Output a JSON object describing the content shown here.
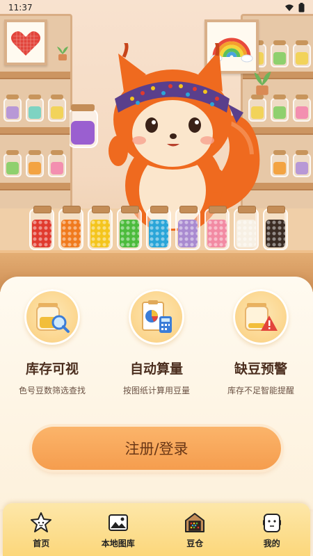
{
  "status_bar": {
    "time": "11:37"
  },
  "features": [
    {
      "title": "库存可视",
      "desc": "色号豆数筛选查找",
      "icon": "jar-search-icon"
    },
    {
      "title": "自动算量",
      "desc": "按图纸计算用豆量",
      "icon": "chart-calculator-icon"
    },
    {
      "title": "缺豆预警",
      "desc": "库存不足智能提醒",
      "icon": "jar-warning-icon"
    }
  ],
  "login_button": {
    "label": "注册/登录"
  },
  "tabs": [
    {
      "label": "首页",
      "icon": "star-mascot-icon"
    },
    {
      "label": "本地图库",
      "icon": "gallery-icon"
    },
    {
      "label": "豆仓",
      "icon": "warehouse-icon"
    },
    {
      "label": "我的",
      "icon": "profile-icon"
    }
  ],
  "colors": {
    "accent": "#f59d4e",
    "tabbar": "#fcd77b",
    "title_text": "#4b2e1e",
    "bead_colors": [
      "#e03a2e",
      "#f07a1e",
      "#f4c51d",
      "#4cbb3c",
      "#2aa5d8",
      "#a98ad0",
      "#f28aa3",
      "#f7f0e4",
      "#3b2c24"
    ]
  }
}
